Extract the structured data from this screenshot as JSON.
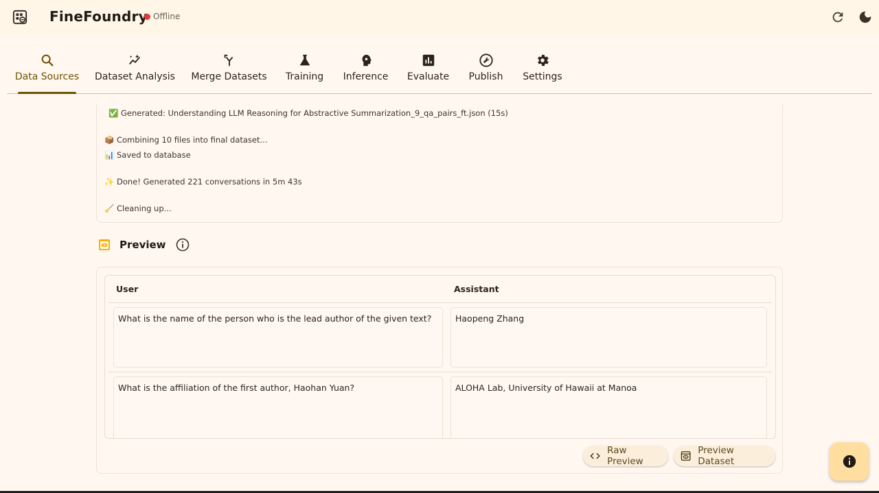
{
  "app": {
    "title": "FineFoundry",
    "status": "Offline",
    "status_color": "#e53935",
    "icons": [
      "app-logo-icon",
      "refresh-icon",
      "dark-mode-icon"
    ]
  },
  "tabs": [
    {
      "label": "Data Sources",
      "icon": "search-icon",
      "active": true
    },
    {
      "label": "Dataset Analysis",
      "icon": "auto-graph-icon",
      "active": false
    },
    {
      "label": "Merge Datasets",
      "icon": "merge-icon",
      "active": false
    },
    {
      "label": "Training",
      "icon": "flask-icon",
      "active": false
    },
    {
      "label": "Inference",
      "icon": "brain-head-icon",
      "active": false
    },
    {
      "label": "Evaluate",
      "icon": "bar-chart-icon",
      "active": false
    },
    {
      "label": "Publish",
      "icon": "build-icon",
      "active": false
    },
    {
      "label": "Settings",
      "icon": "gear-icon",
      "active": false
    }
  ],
  "log": {
    "lines": [
      "✅ Generated: Understanding LLM Reasoning for Abstractive Summarization_9_qa_pairs_ft.json (15s)",
      "📦 Combining 10 files into final dataset...",
      "📊 Saved to database",
      "✨ Done! Generated 221 conversations in 5m 43s",
      "🧹 Cleaning up..."
    ]
  },
  "preview": {
    "title": "Preview",
    "columns": [
      "User",
      "Assistant"
    ],
    "rows": [
      {
        "user": "What is the name of the person who is the lead author of the given text?",
        "assistant": "Haopeng Zhang"
      },
      {
        "user": "What is the affiliation of the first author, Haohan Yuan?",
        "assistant": "ALOHA Lab, University of Hawaii at Manoa"
      }
    ],
    "raw_preview_label": "Raw Preview",
    "preview_dataset_label": "Preview Dataset"
  },
  "colors": {
    "accent": "#6a5200",
    "background": "#fff7f0",
    "fab": "#ffdea0",
    "preview_icon": "#f4b400"
  }
}
